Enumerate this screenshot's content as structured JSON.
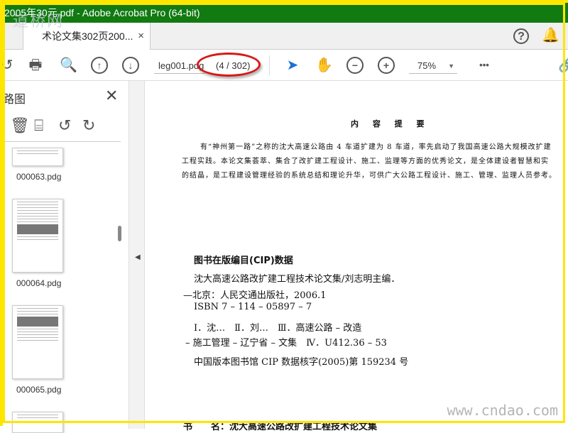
{
  "window": {
    "title": "2005年30元.pdf - Adobe Acrobat Pro (64-bit)",
    "watermark_top": "道桥网",
    "watermark_bottom": "www.cndao.com"
  },
  "tabs": [
    {
      "label": "术论文集302页200...",
      "close": "×"
    }
  ],
  "header": {
    "help": "?",
    "bell": "🔔"
  },
  "toolbar": {
    "page_field": "leg001.pdg",
    "page_count": "(4 / 302)",
    "zoom": "75%",
    "zoom_caret": "▼",
    "more": "•••"
  },
  "panel": {
    "title": "路图",
    "close": "✕",
    "thumbnails": [
      {
        "label": "000063.pdg"
      },
      {
        "label": "000064.pdg"
      },
      {
        "label": "000065.pdg"
      }
    ]
  },
  "document": {
    "heading": "内 容 提 要",
    "summary": [
      "有“神州第一路”之称的沈大高速公路由 4 车道扩建为 8 车道，率先启动了我国高速公路大规模改扩建",
      "工程实践。本论文集荟萃、集合了改扩建工程设计、施工、监理等方面的优秀论文，是全体建设者智慧和实",
      "的结晶，是工程建设管理经验的系统总结和理论升华，可供广大公路工程设计、施工、管理、监理人员参考。"
    ],
    "cip_title": "图书在版编目(CIP)数据",
    "cip_lines": [
      "沈大高速公路改扩建工程技术论文集/刘志明主编．",
      "—北京：人民交通出版社，2006.1",
      "ISBN 7 – 114 – 05897 – 7",
      "Ⅰ．沈…　Ⅱ．刘…　Ⅲ．高速公路 – 改造",
      "– 施工管理 – 辽宁省 – 文集　Ⅳ．U412.36 – 53",
      "中国版本图书馆 CIP 数据核字(2005)第 159234 号"
    ],
    "bottom_line": "书　　名：沈大高速公路改扩建工程技术论文集"
  }
}
